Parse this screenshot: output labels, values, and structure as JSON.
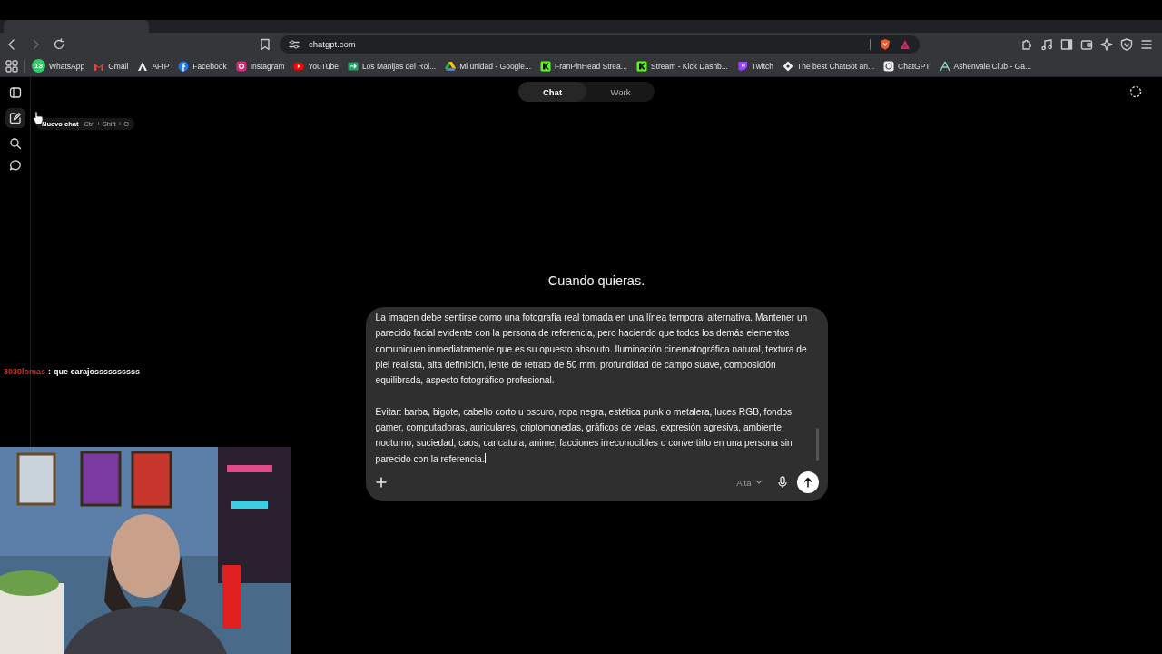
{
  "browser": {
    "address": "chatgpt.com",
    "bookmarks": [
      {
        "label": "WhatsApp",
        "badge": "13"
      },
      {
        "label": "Gmail"
      },
      {
        "label": "AFIP"
      },
      {
        "label": "Facebook"
      },
      {
        "label": "Instagram"
      },
      {
        "label": "YouTube"
      },
      {
        "label": "Los Manijas del Rol..."
      },
      {
        "label": "Mi unidad - Google..."
      },
      {
        "label": "FranPinHead Strea..."
      },
      {
        "label": "Stream - Kick Dashb..."
      },
      {
        "label": "Twitch"
      },
      {
        "label": "The best ChatBot an..."
      },
      {
        "label": "ChatGPT"
      },
      {
        "label": "Ashenvale Club - Ga..."
      }
    ]
  },
  "mode_tabs": [
    {
      "label": "Chat",
      "selected": true
    },
    {
      "label": "Work",
      "selected": false
    }
  ],
  "tooltip": {
    "label": "Nuevo chat",
    "shortcut": "Ctrl + Shift + O"
  },
  "heading": "Cuando quieras.",
  "composer": {
    "value": "La imagen debe sentirse como una fotografía real tomada en una línea temporal alternativa. Mantener un parecido facial evidente con la persona de referencia, pero haciendo que todos los demás elementos comuniquen inmediatamente que es su opuesto absoluto. Iluminación cinematográfica natural, textura de piel realista, alta definición, lente de retrato de 50 mm, profundidad de campo suave, composición equilibrada, aspecto fotográfico profesional.\n\nEvitar: barba, bigote, cabello corto u oscuro, ropa negra, estética punk o metalera, luces RGB, fondos gamer, computadoras, auriculares, criptomonedas, gráficos de velas, expresión agresiva, ambiente nocturno, suciedad, caos, caricatura, anime, facciones irreconocibles o convertirlo en una persona sin parecido con la referencia.",
    "model": "Alta"
  },
  "stream_chat": {
    "user": "3030lomas",
    "separator": ":",
    "message": "que carajossssssssss"
  }
}
